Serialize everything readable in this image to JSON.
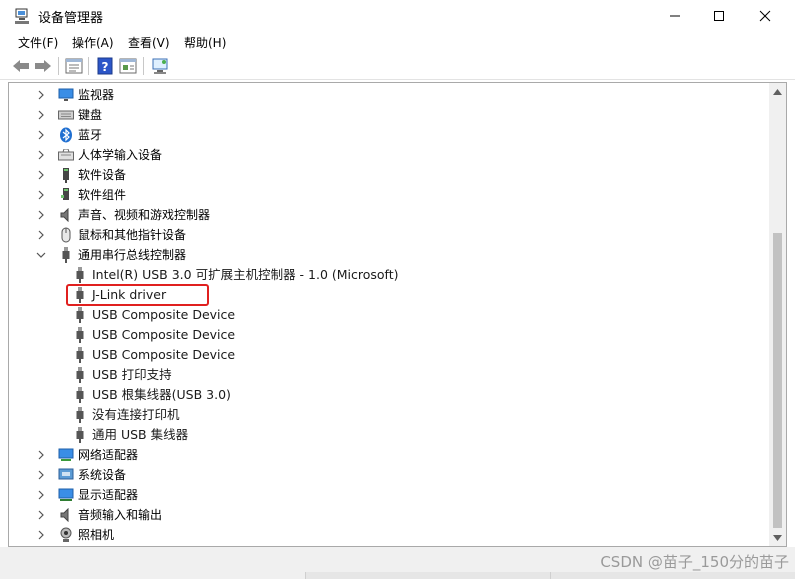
{
  "window": {
    "title": "设备管理器"
  },
  "menu": {
    "file": "文件(F)",
    "action": "操作(A)",
    "view": "查看(V)",
    "help": "帮助(H)"
  },
  "toolbar": {
    "icons": [
      "back-arrow-icon",
      "forward-arrow-icon",
      "properties-icon",
      "help-icon",
      "update-driver-icon",
      "scan-hardware-icon"
    ]
  },
  "tree": {
    "top_items": [
      {
        "label": "监视器"
      },
      {
        "label": "键盘"
      },
      {
        "label": "蓝牙"
      },
      {
        "label": "人体学输入设备"
      },
      {
        "label": "软件设备"
      },
      {
        "label": "软件组件"
      },
      {
        "label": "声音、视频和游戏控制器"
      },
      {
        "label": "鼠标和其他指针设备"
      },
      {
        "label": "通用串行总线控制器"
      }
    ],
    "usb_children": [
      {
        "label": "Intel(R) USB 3.0 可扩展主机控制器 - 1.0 (Microsoft)"
      },
      {
        "label": "J-Link driver"
      },
      {
        "label": "USB Composite Device"
      },
      {
        "label": "USB Composite Device"
      },
      {
        "label": "USB Composite Device"
      },
      {
        "label": "USB 打印支持"
      },
      {
        "label": "USB 根集线器(USB 3.0)"
      },
      {
        "label": "没有连接打印机"
      },
      {
        "label": "通用 USB 集线器"
      }
    ],
    "bottom_items": [
      {
        "label": "网络适配器"
      },
      {
        "label": "系统设备"
      },
      {
        "label": "显示适配器"
      },
      {
        "label": "音频输入和输出"
      },
      {
        "label": "照相机"
      }
    ]
  },
  "watermark": "CSDN @苗子_150分的苗子"
}
